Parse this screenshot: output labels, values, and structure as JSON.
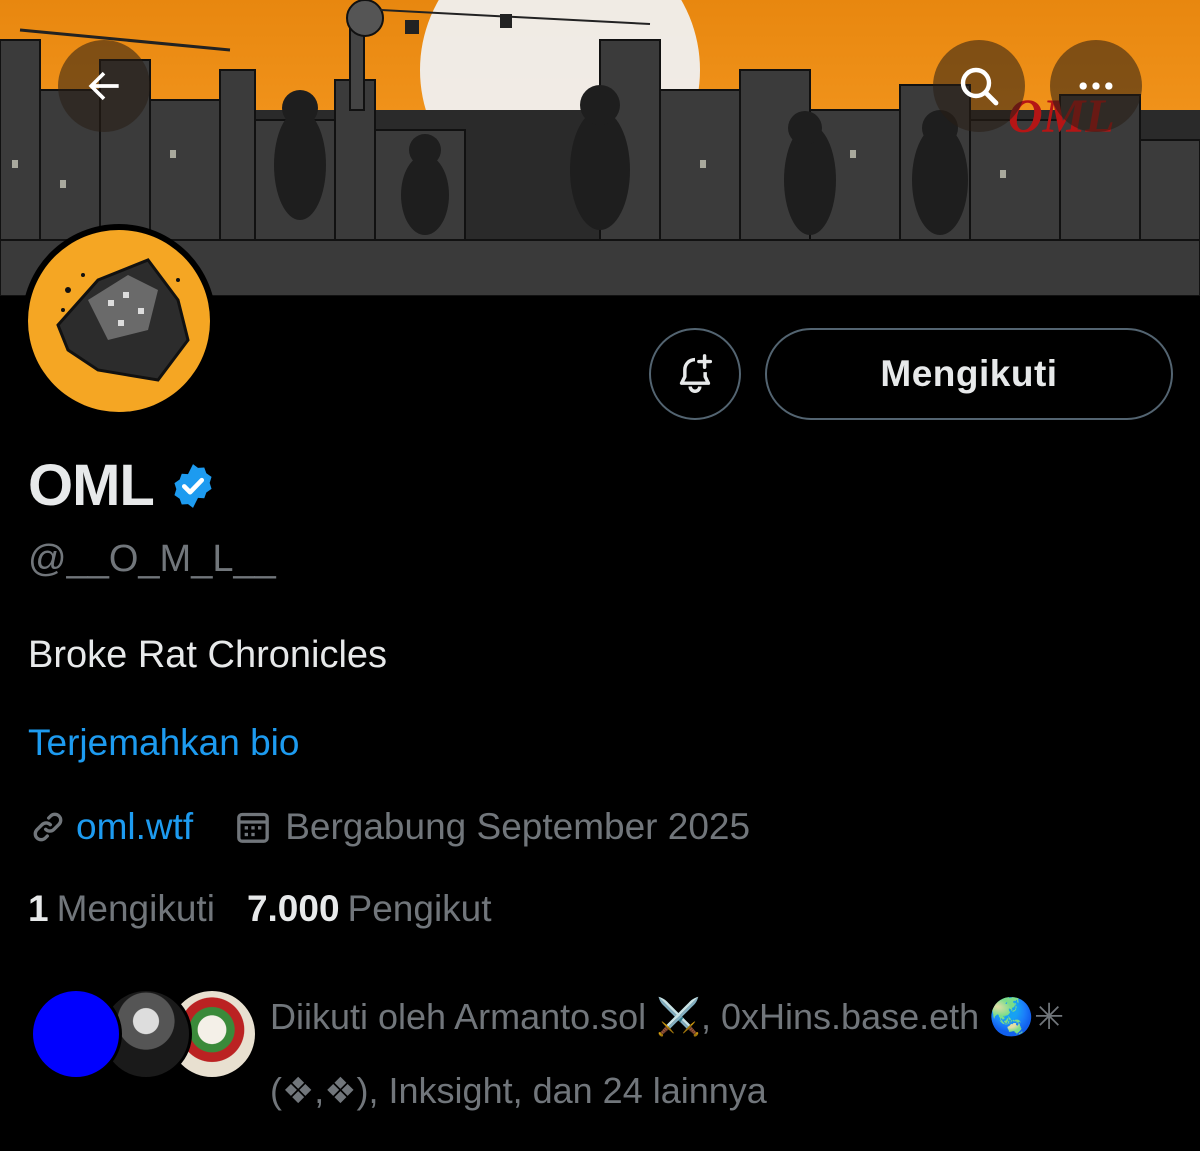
{
  "banner": {
    "watermark_text": "OML",
    "icons": [
      "back-arrow-icon",
      "search-icon",
      "more-icon"
    ]
  },
  "profile": {
    "name": "OML",
    "handle": "@__O_M_L__",
    "bio": "Broke Rat Chronicles",
    "translate_label": "Terjemahkan bio",
    "website": "oml.wtf",
    "joined": "Bergabung September 2025",
    "following_count": "1",
    "following_label": "Mengikuti",
    "followers_count": "7.000",
    "followers_label": "Pengikut"
  },
  "actions": {
    "follow_label": "Mengikuti",
    "notify_icon": "bell-plus-icon"
  },
  "followed_by": {
    "line1": "Diikuti oleh Armanto.sol ⚔️, 0xHins.base.eth 🌏✳",
    "line2": "(❖,❖), Inksight, dan 24 lainnya"
  },
  "colors": {
    "accent": "#1d9bf0",
    "background": "#000000",
    "text_primary": "#e7e9ea",
    "text_secondary": "#71767b",
    "banner_orange": "#f0921a",
    "avatar_orange": "#f5a623"
  }
}
